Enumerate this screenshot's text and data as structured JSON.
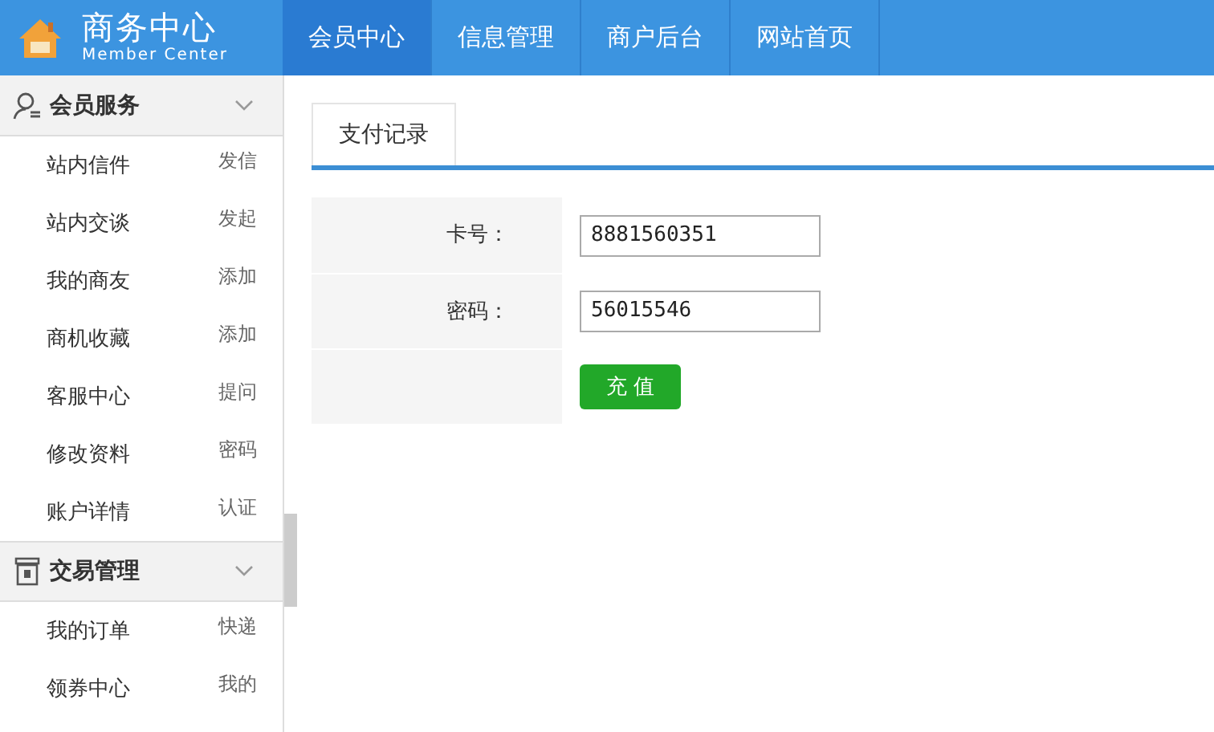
{
  "header": {
    "title": "商务中心",
    "subtitle": "Member Center"
  },
  "nav": [
    {
      "label": "会员中心",
      "selected": true
    },
    {
      "label": "信息管理",
      "selected": false
    },
    {
      "label": "商户后台",
      "selected": false
    },
    {
      "label": "网站首页",
      "selected": false
    }
  ],
  "sidebar": {
    "groups": [
      {
        "title": "会员服务",
        "items": [
          {
            "label": "站内信件",
            "action": "发信"
          },
          {
            "label": "站内交谈",
            "action": "发起"
          },
          {
            "label": "我的商友",
            "action": "添加"
          },
          {
            "label": "商机收藏",
            "action": "添加"
          },
          {
            "label": "客服中心",
            "action": "提问"
          },
          {
            "label": "修改资料",
            "action": "密码"
          },
          {
            "label": "账户详情",
            "action": "认证"
          }
        ]
      },
      {
        "title": "交易管理",
        "items": [
          {
            "label": "我的订单",
            "action": "快递"
          },
          {
            "label": "领券中心",
            "action": "我的"
          }
        ]
      }
    ]
  },
  "tabs": [
    {
      "label": "支付记录",
      "selected": true
    }
  ],
  "form": {
    "fields": [
      {
        "label": "卡号：",
        "value": "8881560351"
      },
      {
        "label": "密码：",
        "value": "56015546"
      }
    ],
    "button": "充 值"
  }
}
